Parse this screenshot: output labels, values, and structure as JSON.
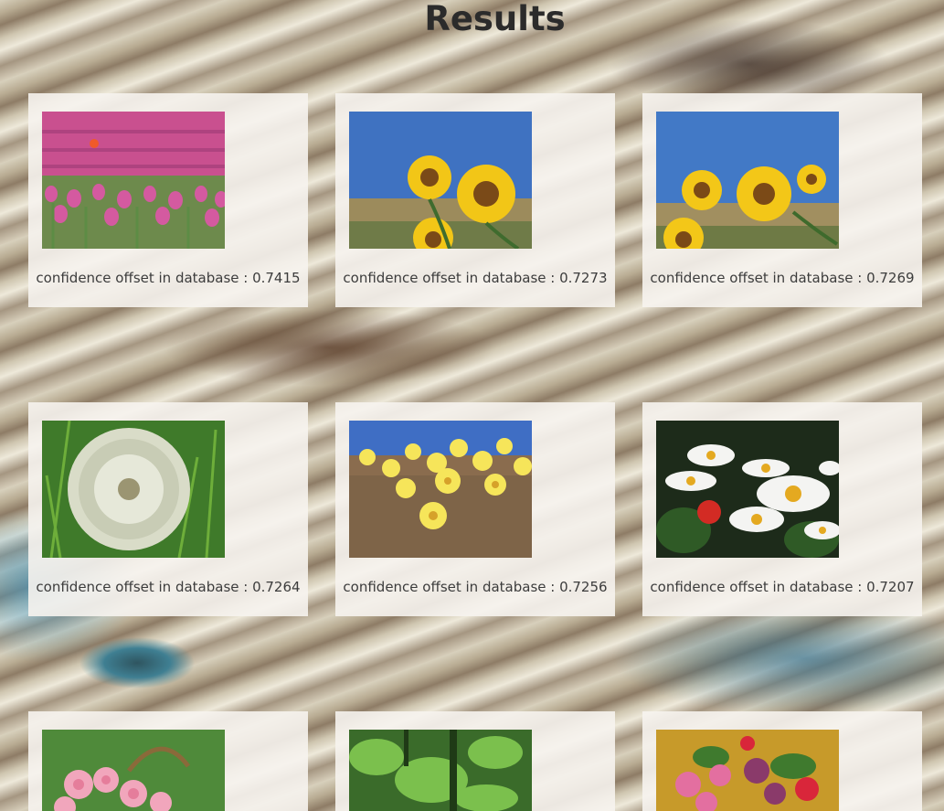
{
  "page": {
    "title": "Results"
  },
  "results": [
    {
      "caption": "confidence offset in database : 0.7415",
      "image": "tulip-field-image"
    },
    {
      "caption": "confidence offset in database : 0.7273",
      "image": "sunflowers-image"
    },
    {
      "caption": "confidence offset in database : 0.7269",
      "image": "sunflowers-image"
    },
    {
      "caption": "confidence offset in database : 0.7264",
      "image": "dandelion-seedhead-image"
    },
    {
      "caption": "confidence offset in database : 0.7256",
      "image": "yellow-wildflowers-image"
    },
    {
      "caption": "confidence offset in database : 0.7207",
      "image": "daisies-image"
    },
    {
      "caption": "",
      "image": "roses-basket-image"
    },
    {
      "caption": "",
      "image": "green-foliage-image"
    },
    {
      "caption": "",
      "image": "flower-bouquet-image"
    }
  ]
}
